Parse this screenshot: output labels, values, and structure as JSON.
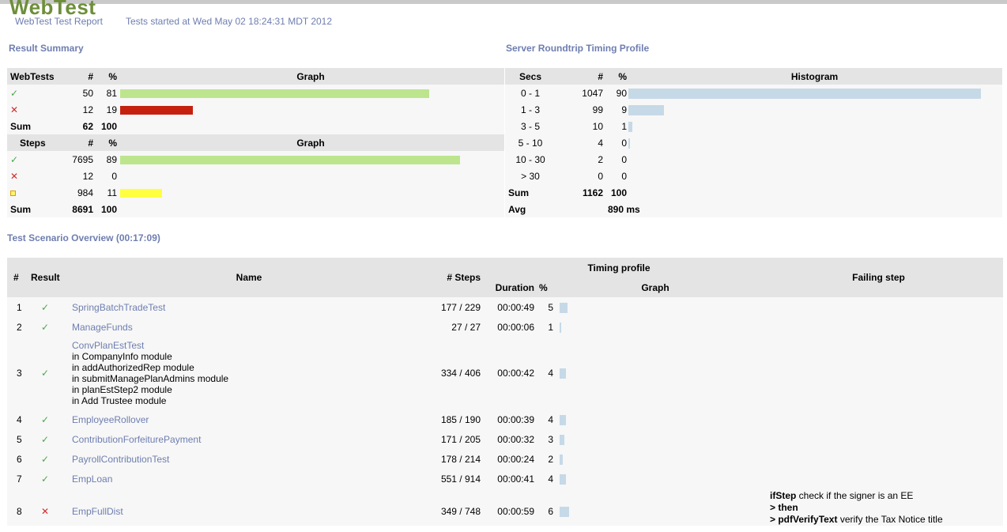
{
  "header": {
    "logo": "WebTest",
    "report_title": "WebTest Test Report",
    "started": "Tests started at Wed May 02 18:24:31 MDT 2012"
  },
  "summary": {
    "title": "Result Summary",
    "webtests": {
      "headers": [
        "WebTests",
        "#",
        "%",
        "Graph"
      ],
      "rows": [
        {
          "icon": "check-icon",
          "count": "50",
          "pct": "81",
          "fill": 0.81,
          "color": "#bde58e"
        },
        {
          "icon": "cross-icon",
          "count": "12",
          "pct": "19",
          "fill": 0.19,
          "color": "#c4210f"
        }
      ],
      "sum": {
        "label": "Sum",
        "count": "62",
        "pct": "100"
      }
    },
    "steps": {
      "headers": [
        "Steps",
        "#",
        "%",
        "Graph"
      ],
      "rows": [
        {
          "icon": "check-icon",
          "count": "7695",
          "pct": "89",
          "fill": 0.89,
          "color": "#bde58e"
        },
        {
          "icon": "cross-icon",
          "count": "12",
          "pct": "0",
          "fill": 0.0,
          "color": "#c4210f"
        },
        {
          "icon": "square-icon",
          "count": "984",
          "pct": "11",
          "fill": 0.11,
          "color": "#ffff40"
        }
      ],
      "sum": {
        "label": "Sum",
        "count": "8691",
        "pct": "100"
      }
    }
  },
  "timing": {
    "title": "Server Roundtrip Timing Profile",
    "headers": [
      "Secs",
      "#",
      "%",
      "Histogram"
    ],
    "rows": [
      {
        "range": "0 - 1",
        "count": "1047",
        "pct": "90",
        "fill": 0.9
      },
      {
        "range": "1 - 3",
        "count": "99",
        "pct": "9",
        "fill": 0.09
      },
      {
        "range": "3 - 5",
        "count": "10",
        "pct": "1",
        "fill": 0.01
      },
      {
        "range": "5 - 10",
        "count": "4",
        "pct": "0",
        "fill": 0.004
      },
      {
        "range": "10 - 30",
        "count": "2",
        "pct": "0",
        "fill": 0
      },
      {
        "range": "> 30",
        "count": "0",
        "pct": "0",
        "fill": 0
      }
    ],
    "sum": {
      "label": "Sum",
      "count": "1162",
      "pct": "100"
    },
    "avg": {
      "label": "Avg",
      "value": "890 ms"
    }
  },
  "scenario": {
    "title": "Test Scenario Overview (00:17:09)",
    "headers": {
      "num": "#",
      "result": "Result",
      "name": "Name",
      "steps": "# Steps",
      "timing": "Timing profile",
      "duration": "Duration",
      "pct": "%",
      "graph": "Graph",
      "failing": "Failing step"
    },
    "rows": [
      {
        "num": "1",
        "result": "check-icon",
        "name": "SpringBatchTradeTest",
        "modules": [],
        "steps": "177 / 229",
        "duration": "00:00:49",
        "pct": "5",
        "fill": 0.05
      },
      {
        "num": "2",
        "result": "check-icon",
        "name": "ManageFunds",
        "modules": [],
        "steps": "27 / 27",
        "duration": "00:00:06",
        "pct": "1",
        "fill": 0.01
      },
      {
        "num": "3",
        "result": "check-icon",
        "name": "ConvPlanEstTest",
        "modules": [
          "in CompanyInfo module",
          "in addAuthorizedRep module",
          "in submitManagePlanAdmins module",
          "in planEstStep2 module",
          "in Add Trustee module"
        ],
        "steps": "334 / 406",
        "duration": "00:00:42",
        "pct": "4",
        "fill": 0.04
      },
      {
        "num": "4",
        "result": "check-icon",
        "name": "EmployeeRollover",
        "modules": [],
        "steps": "185 / 190",
        "duration": "00:00:39",
        "pct": "4",
        "fill": 0.04
      },
      {
        "num": "5",
        "result": "check-icon",
        "name": "ContributionForfeiturePayment",
        "modules": [],
        "steps": "171 / 205",
        "duration": "00:00:32",
        "pct": "3",
        "fill": 0.03
      },
      {
        "num": "6",
        "result": "check-icon",
        "name": "PayrollContributionTest",
        "modules": [],
        "steps": "178 / 214",
        "duration": "00:00:24",
        "pct": "2",
        "fill": 0.02
      },
      {
        "num": "7",
        "result": "check-icon",
        "name": "EmpLoan",
        "modules": [],
        "steps": "551 / 914",
        "duration": "00:00:41",
        "pct": "4",
        "fill": 0.04
      },
      {
        "num": "8",
        "result": "cross-icon",
        "name": "EmpFullDist",
        "modules": [],
        "steps": "349 / 748",
        "duration": "00:00:59",
        "pct": "6",
        "fill": 0.06
      }
    ],
    "failing_step": {
      "line1_bold": "ifStep",
      "line1_rest": " check if the signer is an EE",
      "line2": "> then",
      "line3_bold": "> pdfVerifyText",
      "line3_rest": " verify the Tax Notice title"
    }
  }
}
